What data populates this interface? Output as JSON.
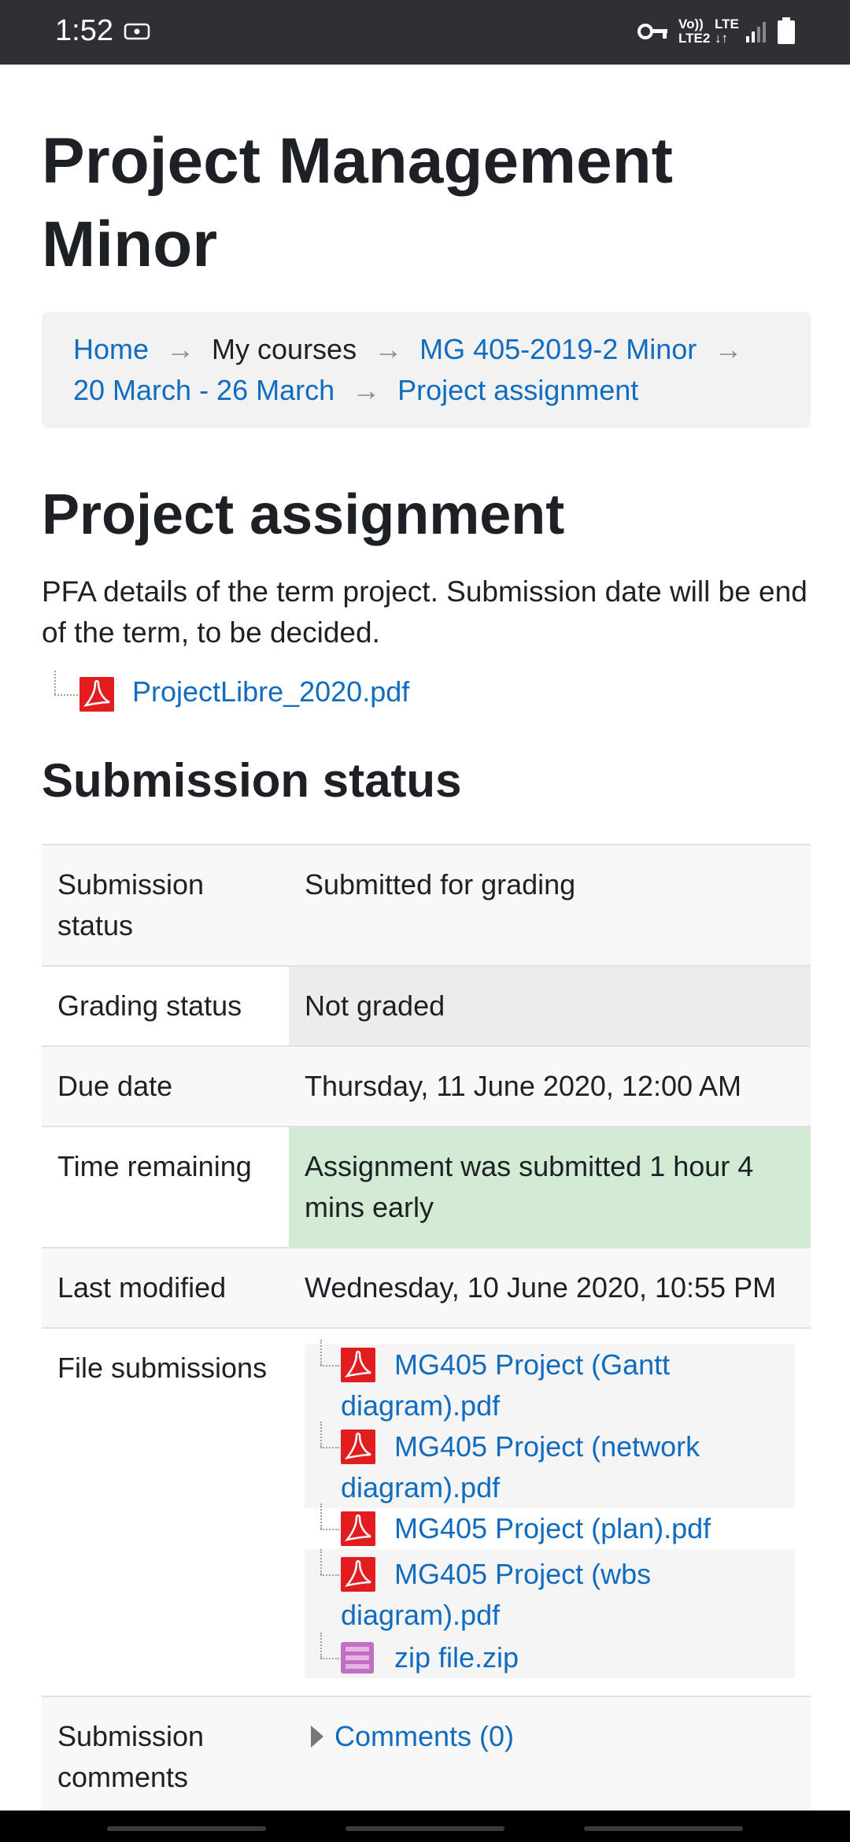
{
  "status_bar": {
    "time": "1:52",
    "icons": [
      "screen-record-icon",
      "vpn-key-icon",
      "volte-icon",
      "lte-signal-icon",
      "signal-bars-icon",
      "battery-icon"
    ],
    "volte_label": "Vo))",
    "lte2_label": "LTE2",
    "lte_label": "LTE"
  },
  "page": {
    "course_title": "Project Management Minor",
    "breadcrumb": {
      "home": "Home",
      "my_courses": "My courses",
      "course": "MG 405-2019-2 Minor",
      "section": "20 March - 26 March",
      "activity": "Project assignment",
      "separator": "→"
    },
    "activity_title": "Project assignment",
    "intro": "PFA details of the term project. Submission date will be end of the term, to be decided.",
    "attachment": "ProjectLibre_2020.pdf",
    "section_title": "Submission status"
  },
  "submission": {
    "rows": [
      {
        "label": "Submission status",
        "value": "Submitted for grading"
      },
      {
        "label": "Grading status",
        "value": "Not graded"
      },
      {
        "label": "Due date",
        "value": "Thursday, 11 June 2020, 12:00 AM"
      },
      {
        "label": "Time remaining",
        "value": "Assignment was submitted 1 hour 4 mins early"
      },
      {
        "label": "Last modified",
        "value": "Wednesday, 10 June 2020, 10:55 PM"
      },
      {
        "label": "File submissions"
      },
      {
        "label": "Submission comments"
      }
    ],
    "files": [
      "MG405 Project (Gantt diagram).pdf",
      "MG405 Project (network diagram).pdf",
      "MG405 Project (plan).pdf",
      "MG405 Project (wbs diagram).pdf",
      "zip file.zip"
    ],
    "comments_link": "Comments (0)"
  },
  "colors": {
    "link": "#0f6cbf",
    "text": "#1d2125",
    "status_bar": "#2f3033",
    "success_bg": "#d2ebd2",
    "pdf_red": "#e11d20",
    "zip_purple": "#c070c0"
  }
}
